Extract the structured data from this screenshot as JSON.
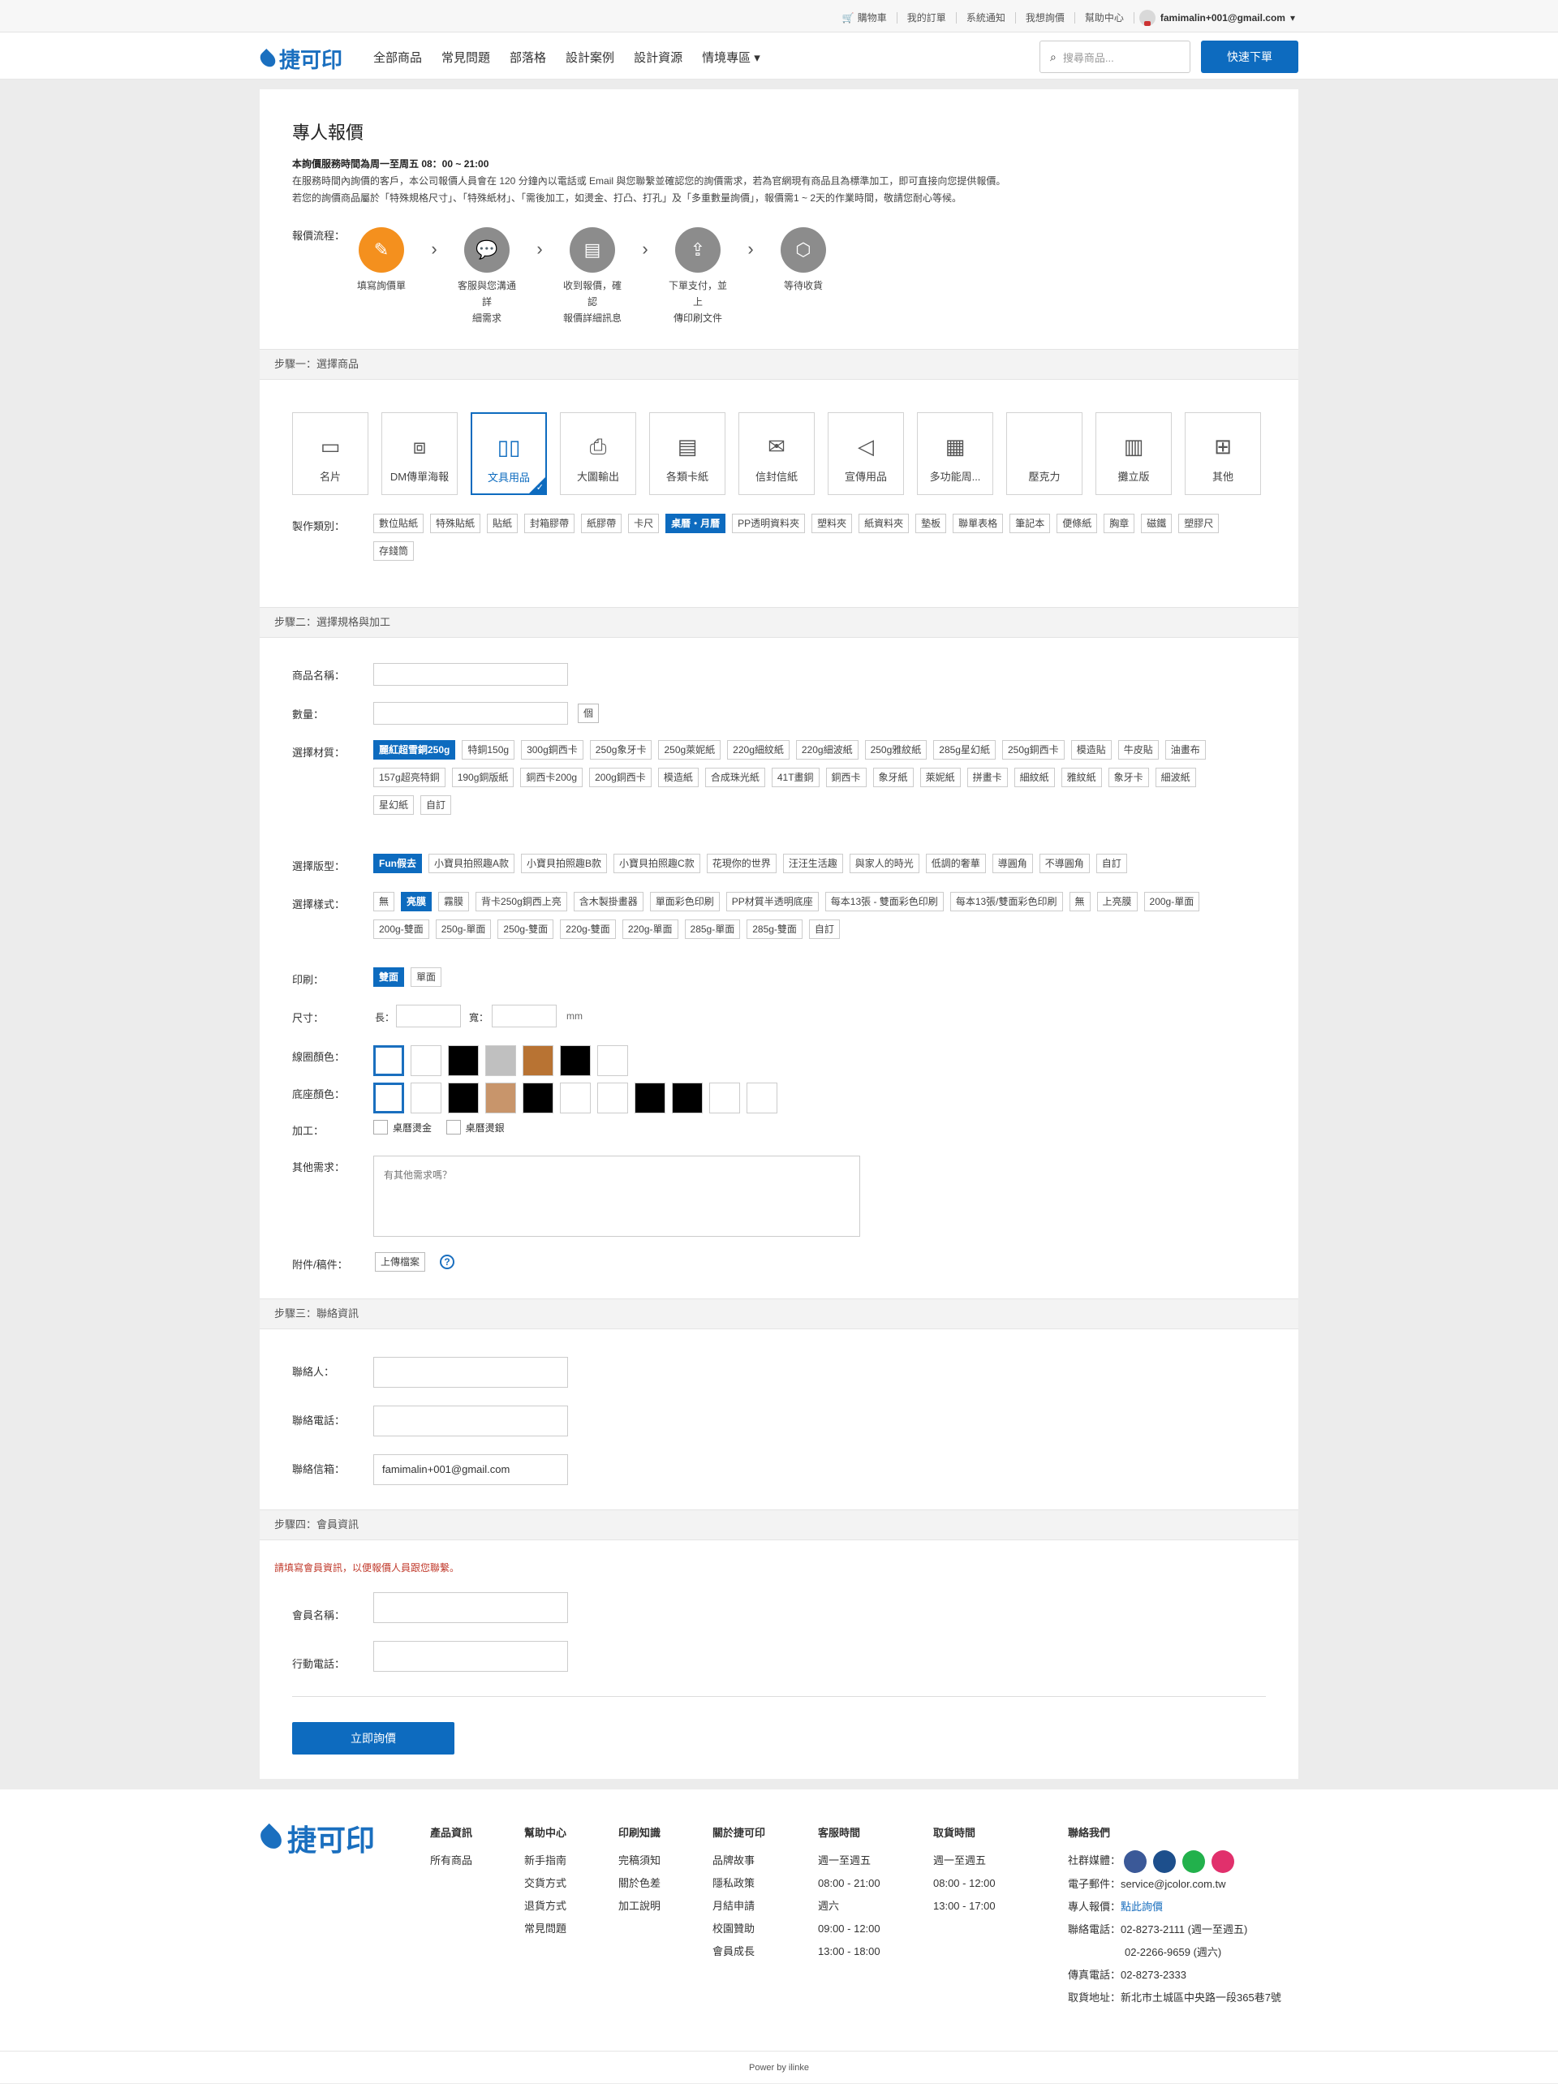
{
  "topbar": {
    "cart": "購物車",
    "orders": "我的訂單",
    "notice": "系統通知",
    "quote": "我想詢價",
    "help": "幫助中心",
    "email": "famimalin+001@gmail.com"
  },
  "nav": {
    "logo": "捷可印",
    "menu": [
      "全部商品",
      "常見問題",
      "部落格",
      "設計案例",
      "設計資源",
      "情境專區 ▾"
    ],
    "search_placeholder": "搜尋商品...",
    "quick_order": "快速下單"
  },
  "page": {
    "title": "專人報價",
    "hours": "本詢價服務時間為周一至周五 08：00 ~ 21:00",
    "desc1": "在服務時間內詢價的客戶，本公司報價人員會在 120 分鐘內以電話或 Email 與您聯繫並確認您的詢價需求，若為官網現有商品且為標準加工，即可直接向您提供報價。",
    "desc2": "若您的詢價商品屬於「特殊規格尺寸」、「特殊紙材」、「需後加工，如燙金、打凸、打孔」及「多重數量詢價」，報價需1 ~ 2天的作業時間，敬請您耐心等候。",
    "flow_label": "報價流程：",
    "flow": [
      {
        "l1": "填寫詢價單",
        "l2": ""
      },
      {
        "l1": "客服與您溝通詳",
        "l2": "細需求"
      },
      {
        "l1": "收到報價，確認",
        "l2": "報價詳細訊息"
      },
      {
        "l1": "下單支付，並上",
        "l2": "傳印刷文件"
      },
      {
        "l1": "等待收貨",
        "l2": ""
      }
    ]
  },
  "step1": {
    "title": "步驟一：選擇商品",
    "categories": [
      {
        "label": "名片",
        "icon": "▭"
      },
      {
        "label": "DM傳單海報",
        "icon": "▯"
      },
      {
        "label": "文具用品",
        "icon": "▯"
      },
      {
        "label": "大圖輸出",
        "icon": "⎙"
      },
      {
        "label": "各類卡紙",
        "icon": "▤"
      },
      {
        "label": "信封信紙",
        "icon": "✉"
      },
      {
        "label": "宣傳用品",
        "icon": "📢"
      },
      {
        "label": "多功能周...",
        "icon": "▦"
      },
      {
        "label": "壓克力",
        "icon": ""
      },
      {
        "label": "攤立版",
        "icon": "▥"
      },
      {
        "label": "其他",
        "icon": "▦"
      }
    ],
    "type_label": "製作類別：",
    "types": [
      "數位貼紙",
      "特殊貼紙",
      "貼紙",
      "封箱膠帶",
      "紙膠帶",
      "卡尺",
      "桌曆・月曆",
      "PP透明資料夾",
      "塑料夾",
      "紙資料夾",
      "墊板",
      "聯單表格",
      "筆記本",
      "便條紙",
      "胸章",
      "磁鐵",
      "塑膠尺",
      "存錢筒"
    ]
  },
  "step2": {
    "title": "步驟二：選擇規格與加工",
    "name_label": "商品名稱：",
    "qty_label": "數量：",
    "qty_unit": "個",
    "material_label": "選擇材質：",
    "materials": [
      "麗紅超雪銅250g",
      "特銅150g",
      "300g銅西卡",
      "250g象牙卡",
      "250g萊妮紙",
      "220g細紋紙",
      "220g細波紙",
      "250g雅紋紙",
      "285g星幻紙",
      "250g銅西卡",
      "模造貼",
      "牛皮貼",
      "油畫布",
      "157g超亮特銅",
      "190g銅版紙",
      "銅西卡200g",
      "200g銅西卡",
      "模造紙",
      "合成珠光紙",
      "41T畫銅",
      "銅西卡",
      "象牙紙",
      "萊妮紙",
      "拼畫卡",
      "細紋紙",
      "雅紋紙",
      "象牙卡",
      "細波紙",
      "星幻紙",
      "自訂"
    ],
    "layout_label": "選擇版型：",
    "layouts": [
      "Fun假去",
      "小寶貝拍照趣A款",
      "小寶貝拍照趣B款",
      "小寶貝拍照趣C款",
      "花現你的世界",
      "汪汪生活趣",
      "與家人的時光",
      "低調的奢華",
      "導圓角",
      "不導圓角",
      "自訂"
    ],
    "style_label": "選擇樣式：",
    "styles": [
      "無",
      "亮膜",
      "霧膜",
      "背卡250g銅西上亮",
      "含木製掛畫器",
      "單面彩色印刷",
      "PP材質半透明底座",
      "每本13張 - 雙面彩色印刷",
      "每本13張/雙面彩色印刷",
      "無",
      "上亮膜",
      "200g-單面",
      "200g-雙面",
      "250g-單面",
      "250g-雙面",
      "220g-雙面",
      "220g-單面",
      "285g-單面",
      "285g-雙面",
      "自訂"
    ],
    "print_label": "印刷：",
    "prints": [
      "雙面",
      "單面"
    ],
    "size_label": "尺寸：",
    "len_label": "長：",
    "wid_label": "寬：",
    "unit": "mm",
    "line_color_label": "線圈顏色：",
    "line_colors": [
      "#ffffff",
      "#ffffff",
      "#000000",
      "#c0c0c0",
      "#b87333",
      "#000000",
      "#ffffff"
    ],
    "base_color_label": "底座顏色：",
    "base_colors": [
      "#ffffff",
      "#ffffff",
      "#000000",
      "#c8956b",
      "#000000",
      "#ffffff",
      "#ffffff",
      "#000000",
      "#000000",
      "#ffffff",
      "#ffffff"
    ],
    "process_label": "加工：",
    "processes": [
      "桌曆燙金",
      "桌曆燙銀"
    ],
    "other_label": "其他需求：",
    "other_placeholder": "有其他需求嗎？",
    "attach_label": "附件/稿件：",
    "upload": "上傳檔案"
  },
  "step3": {
    "title": "步驟三：聯絡資訊",
    "contact_label": "聯絡人：",
    "phone_label": "聯絡電話：",
    "email_label": "聯絡信箱：",
    "email_value": "famimalin+001@gmail.com"
  },
  "step4": {
    "title": "步驟四：會員資訊",
    "warning": "請填寫會員資訊，以便報價人員跟您聯繫。",
    "member_label": "會員名稱：",
    "mobile_label": "行動電話："
  },
  "submit": "立即詢價",
  "footer": {
    "logo": "捷可印",
    "cols": [
      {
        "title": "產品資訊",
        "items": [
          "所有商品"
        ]
      },
      {
        "title": "幫助中心",
        "items": [
          "新手指南",
          "交貨方式",
          "退貨方式",
          "常見問題"
        ]
      },
      {
        "title": "印刷知識",
        "items": [
          "完稿須知",
          "關於色差",
          "加工說明"
        ]
      },
      {
        "title": "關於捷可印",
        "items": [
          "品牌故事",
          "隱私政策",
          "月結申請",
          "校園贊助",
          "會員成長"
        ]
      },
      {
        "title": "客服時間",
        "items": [
          "週一至週五",
          "08:00 - 21:00",
          "週六",
          "09:00 - 12:00",
          "13:00 - 18:00"
        ]
      },
      {
        "title": "取貨時間",
        "items": [
          "週一至週五",
          "08:00 - 12:00",
          "13:00 - 17:00"
        ]
      }
    ],
    "contact_title": "聯絡我們",
    "social_label": "社群媒體：",
    "social_colors": [
      "#3b5998",
      "#1d4f8c",
      "#22b14c",
      "#e1306c"
    ],
    "mail": "電子郵件：service@jcolor.com.tw",
    "quote_label": "專人報價：",
    "quote_link": "點此詢價",
    "tel1": "聯絡電話：02-8273-2111 (週一至週五)",
    "tel2": "02-2266-9659 (週六)",
    "fax": "傳真電話：02-8273-2333",
    "addr": "取貨地址：新北市土城區中央路一段365巷7號"
  },
  "powered": "Power by ilinke"
}
